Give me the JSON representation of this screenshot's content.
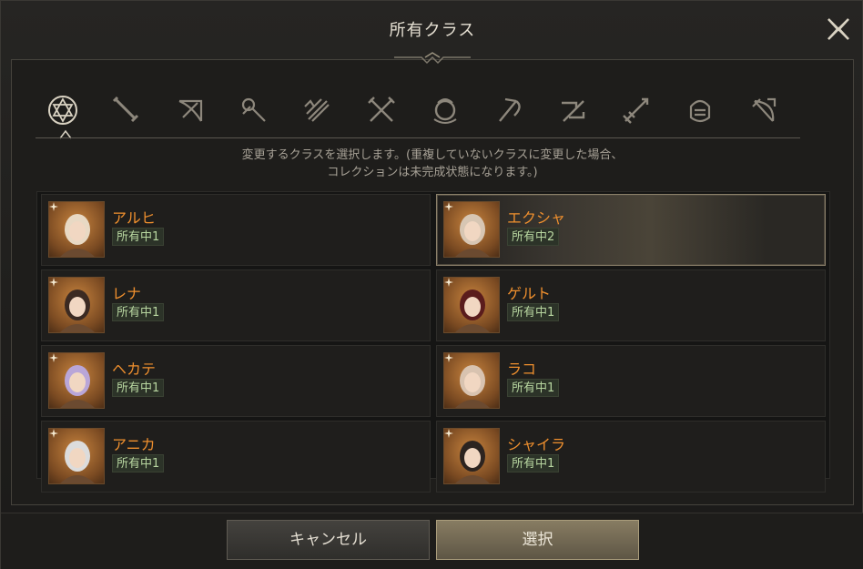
{
  "dialog": {
    "title": "所有クラス",
    "description_line1": "変更するクラスを選択します。(重複していないクラスに変更した場合、",
    "description_line2": "コレクションは未完成状態になります。)"
  },
  "class_tabs": [
    {
      "icon": "hexagram-all-icon"
    },
    {
      "icon": "greatsword-icon"
    },
    {
      "icon": "crossbow-icon"
    },
    {
      "icon": "staff-icon"
    },
    {
      "icon": "quiver-icon"
    },
    {
      "icon": "dual-daggers-icon"
    },
    {
      "icon": "orb-icon"
    },
    {
      "icon": "scythe-icon"
    },
    {
      "icon": "twin-guns-icon"
    },
    {
      "icon": "spear-icon"
    },
    {
      "icon": "gauntlet-icon"
    },
    {
      "icon": "bow-icon"
    }
  ],
  "classes": [
    {
      "name": "アルヒ",
      "owned": "所有中1",
      "selected": false
    },
    {
      "name": "エクシャ",
      "owned": "所有中2",
      "selected": true
    },
    {
      "name": "レナ",
      "owned": "所有中1",
      "selected": false
    },
    {
      "name": "ゲルト",
      "owned": "所有中1",
      "selected": false
    },
    {
      "name": "ヘカテ",
      "owned": "所有中1",
      "selected": false
    },
    {
      "name": "ラコ",
      "owned": "所有中1",
      "selected": false
    },
    {
      "name": "アニカ",
      "owned": "所有中1",
      "selected": false
    },
    {
      "name": "シャイラ",
      "owned": "所有中1",
      "selected": false
    }
  ],
  "buttons": {
    "cancel": "キャンセル",
    "select": "選択"
  },
  "colors": {
    "accent_name": "#f0902e",
    "badge_text": "#b8d6a0",
    "select_button": "#877c62"
  }
}
